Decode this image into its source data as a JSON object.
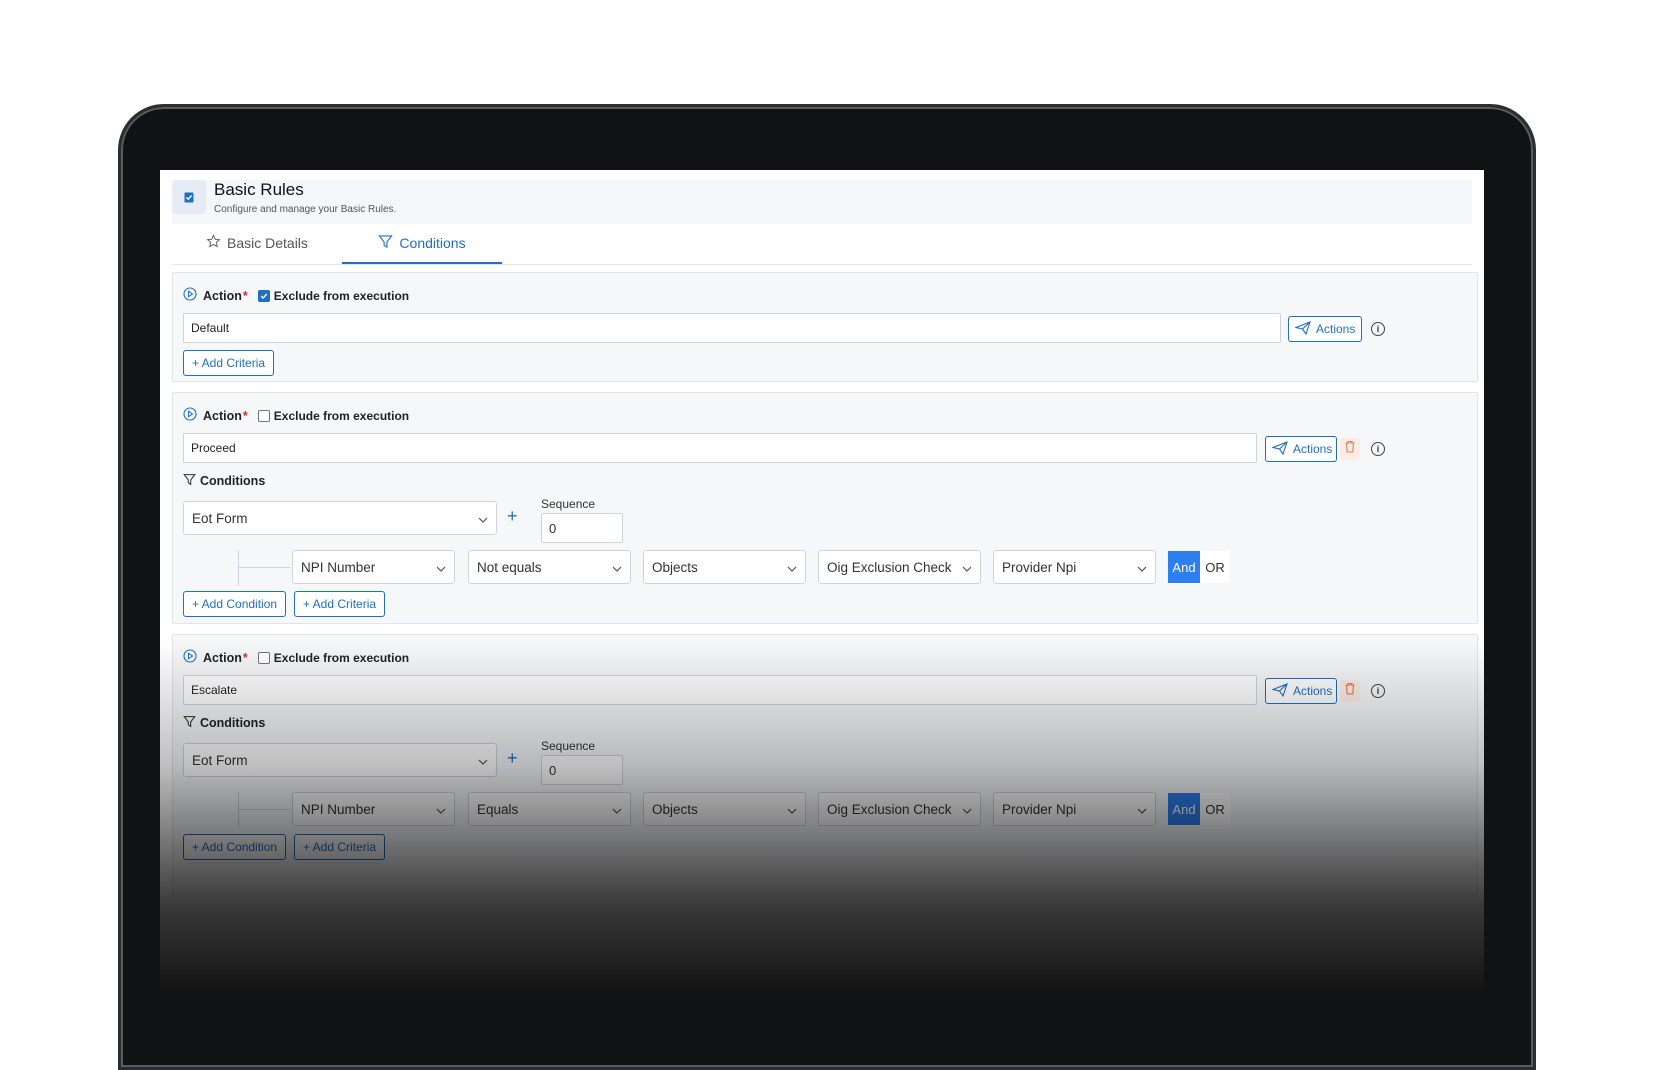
{
  "header": {
    "title": "Basic Rules",
    "subtitle": "Configure and manage your Basic Rules."
  },
  "tabs": [
    {
      "label": "Basic Details",
      "icon": "star-icon",
      "active": false
    },
    {
      "label": "Conditions",
      "icon": "filter-icon",
      "active": true
    }
  ],
  "actions": [
    {
      "label": "Action",
      "required_mark": "*",
      "exclude_label": "Exclude from execution",
      "exclude_checked": true,
      "value": "Default",
      "actions_button": "Actions",
      "add_criteria": "+ Add Criteria"
    },
    {
      "label": "Action",
      "required_mark": "*",
      "exclude_label": "Exclude from execution",
      "exclude_checked": false,
      "value": "Proceed",
      "actions_button": "Actions",
      "conditions_label": "Conditions",
      "form_select": "Eot Form",
      "sequence_label": "Sequence",
      "sequence_value": "0",
      "condition_row": [
        "NPI Number",
        "Not equals",
        "Objects",
        "Oig Exclusion Check",
        "Provider Npi"
      ],
      "and_label": "And",
      "or_label": "OR",
      "add_condition": "+ Add Condition",
      "add_criteria": "+ Add Criteria"
    },
    {
      "label": "Action",
      "required_mark": "*",
      "exclude_label": "Exclude from execution",
      "exclude_checked": false,
      "value": "Escalate",
      "actions_button": "Actions",
      "conditions_label": "Conditions",
      "form_select": "Eot Form",
      "sequence_label": "Sequence",
      "sequence_value": "0",
      "condition_row": [
        "NPI Number",
        "Equals",
        "Objects",
        "Oig Exclusion Check",
        "Provider Npi"
      ],
      "and_label": "And",
      "or_label": "OR",
      "add_condition": "+ Add Condition",
      "add_criteria": "+ Add Criteria"
    }
  ],
  "colors": {
    "accent": "#1f6fc5",
    "and_button": "#2d7ef0",
    "required": "#d93025",
    "delete_bg": "#fdece6"
  }
}
